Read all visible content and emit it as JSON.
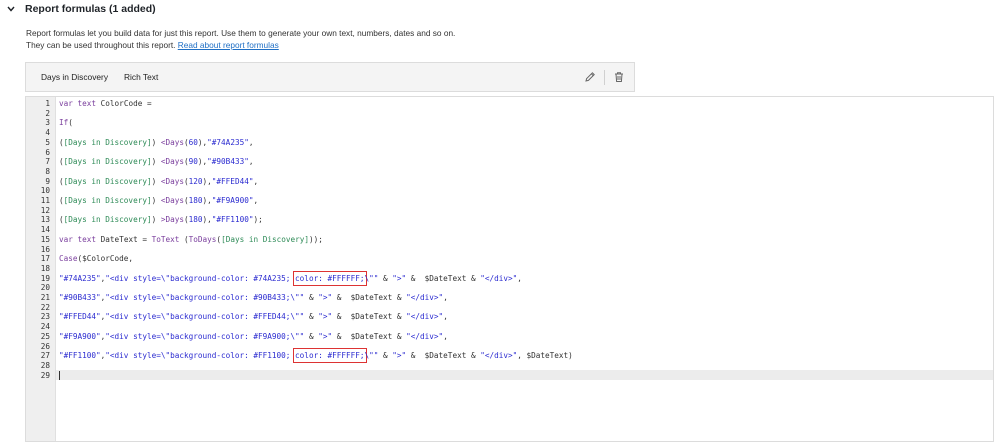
{
  "section": {
    "title": "Report formulas (1 added)"
  },
  "description": {
    "line1": "Report formulas let you build data for just this report. Use them to generate your own text, numbers, dates and so on.",
    "line2": "They can be used throughout this report.",
    "link": "Read about report formulas"
  },
  "formula_bar": {
    "name": "Days in Discovery",
    "type": "Rich Text",
    "edit_icon": "pencil-icon",
    "delete_icon": "trash-icon"
  },
  "editor": {
    "lines": [
      {
        "n": "1",
        "tokens": [
          [
            "kw",
            "var "
          ],
          [
            "kw",
            "text "
          ],
          [
            "plain",
            "ColorCode ="
          ]
        ]
      },
      {
        "n": "2",
        "tokens": []
      },
      {
        "n": "3",
        "tokens": [
          [
            "fn",
            "If"
          ],
          [
            "plain",
            "("
          ]
        ]
      },
      {
        "n": "4",
        "tokens": []
      },
      {
        "n": "5",
        "tokens": [
          [
            "plain",
            "("
          ],
          [
            "field",
            "[Days in Discovery]"
          ],
          [
            "plain",
            ") "
          ],
          [
            "fn",
            "<Days"
          ],
          [
            "plain",
            "("
          ],
          [
            "num",
            "60"
          ],
          [
            "plain",
            "),"
          ],
          [
            "str",
            "\"#74A235\""
          ],
          [
            "plain",
            ","
          ]
        ]
      },
      {
        "n": "6",
        "tokens": []
      },
      {
        "n": "7",
        "tokens": [
          [
            "plain",
            "("
          ],
          [
            "field",
            "[Days in Discovery]"
          ],
          [
            "plain",
            ") "
          ],
          [
            "fn",
            "<Days"
          ],
          [
            "plain",
            "("
          ],
          [
            "num",
            "90"
          ],
          [
            "plain",
            "),"
          ],
          [
            "str",
            "\"#90B433\""
          ],
          [
            "plain",
            ","
          ]
        ]
      },
      {
        "n": "8",
        "tokens": []
      },
      {
        "n": "9",
        "tokens": [
          [
            "plain",
            "("
          ],
          [
            "field",
            "[Days in Discovery]"
          ],
          [
            "plain",
            ") "
          ],
          [
            "fn",
            "<Days"
          ],
          [
            "plain",
            "("
          ],
          [
            "num",
            "120"
          ],
          [
            "plain",
            "),"
          ],
          [
            "str",
            "\"#FFED44\""
          ],
          [
            "plain",
            ","
          ]
        ]
      },
      {
        "n": "10",
        "tokens": []
      },
      {
        "n": "11",
        "tokens": [
          [
            "plain",
            "("
          ],
          [
            "field",
            "[Days in Discovery]"
          ],
          [
            "plain",
            ") "
          ],
          [
            "fn",
            "<Days"
          ],
          [
            "plain",
            "("
          ],
          [
            "num",
            "180"
          ],
          [
            "plain",
            "),"
          ],
          [
            "str",
            "\"#F9A900\""
          ],
          [
            "plain",
            ","
          ]
        ]
      },
      {
        "n": "12",
        "tokens": []
      },
      {
        "n": "13",
        "tokens": [
          [
            "plain",
            "("
          ],
          [
            "field",
            "[Days in Discovery]"
          ],
          [
            "plain",
            ") "
          ],
          [
            "fn",
            ">Days"
          ],
          [
            "plain",
            "("
          ],
          [
            "num",
            "180"
          ],
          [
            "plain",
            "),"
          ],
          [
            "str",
            "\"#FF1100\""
          ],
          [
            "plain",
            ");"
          ]
        ]
      },
      {
        "n": "14",
        "tokens": []
      },
      {
        "n": "15",
        "tokens": [
          [
            "kw",
            "var "
          ],
          [
            "kw",
            "text "
          ],
          [
            "plain",
            "DateText = "
          ],
          [
            "fn",
            "ToText "
          ],
          [
            "plain",
            "("
          ],
          [
            "fn",
            "ToDays"
          ],
          [
            "plain",
            "("
          ],
          [
            "field",
            "[Days in Discovery]"
          ],
          [
            "plain",
            "));"
          ]
        ]
      },
      {
        "n": "16",
        "tokens": []
      },
      {
        "n": "17",
        "tokens": [
          [
            "fn",
            "Case"
          ],
          [
            "plain",
            "($ColorCode,"
          ]
        ]
      },
      {
        "n": "18",
        "tokens": []
      },
      {
        "n": "19",
        "tokens": [
          [
            "str",
            "\"#74A235\""
          ],
          [
            "plain",
            ","
          ],
          [
            "str",
            "\"<div style=\\\"background-color: #74A235; color: #FFFFFF;\\\"\""
          ],
          [
            "plain",
            " & "
          ],
          [
            "str",
            "\">\""
          ],
          [
            "plain",
            " &  $DateText & "
          ],
          [
            "str",
            "\"</div>\""
          ],
          [
            "plain",
            ","
          ]
        ]
      },
      {
        "n": "20",
        "tokens": []
      },
      {
        "n": "21",
        "tokens": [
          [
            "str",
            "\"#90B433\""
          ],
          [
            "plain",
            ","
          ],
          [
            "str",
            "\"<div style=\\\"background-color: #90B433;\\\"\""
          ],
          [
            "plain",
            " & "
          ],
          [
            "str",
            "\">\""
          ],
          [
            "plain",
            " &  $DateText & "
          ],
          [
            "str",
            "\"</div>\""
          ],
          [
            "plain",
            ","
          ]
        ]
      },
      {
        "n": "22",
        "tokens": []
      },
      {
        "n": "23",
        "tokens": [
          [
            "str",
            "\"#FFED44\""
          ],
          [
            "plain",
            ","
          ],
          [
            "str",
            "\"<div style=\\\"background-color: #FFED44;\\\"\""
          ],
          [
            "plain",
            " & "
          ],
          [
            "str",
            "\">\""
          ],
          [
            "plain",
            " &  $DateText & "
          ],
          [
            "str",
            "\"</div>\""
          ],
          [
            "plain",
            ","
          ]
        ]
      },
      {
        "n": "24",
        "tokens": []
      },
      {
        "n": "25",
        "tokens": [
          [
            "str",
            "\"#F9A900\""
          ],
          [
            "plain",
            ","
          ],
          [
            "str",
            "\"<div style=\\\"background-color: #F9A900;\\\"\""
          ],
          [
            "plain",
            " & "
          ],
          [
            "str",
            "\">\""
          ],
          [
            "plain",
            " &  $DateText & "
          ],
          [
            "str",
            "\"</div>\""
          ],
          [
            "plain",
            ","
          ]
        ]
      },
      {
        "n": "26",
        "tokens": []
      },
      {
        "n": "27",
        "tokens": [
          [
            "str",
            "\"#FF1100\""
          ],
          [
            "plain",
            ","
          ],
          [
            "str",
            "\"<div style=\\\"background-color: #FF1100; color: #FFFFFF;\\\"\""
          ],
          [
            "plain",
            " & "
          ],
          [
            "str",
            "\">\""
          ],
          [
            "plain",
            " &  $DateText & "
          ],
          [
            "str",
            "\"</div>\""
          ],
          [
            "plain",
            ", $DateText)"
          ]
        ]
      },
      {
        "n": "28",
        "tokens": []
      },
      {
        "n": "29",
        "tokens": []
      }
    ]
  },
  "colors": {
    "keyword": "#7a3e9d",
    "field": "#2e8b57",
    "string": "#2b2bd0",
    "highlight": "#dd3333",
    "link": "#1f6fc5"
  }
}
